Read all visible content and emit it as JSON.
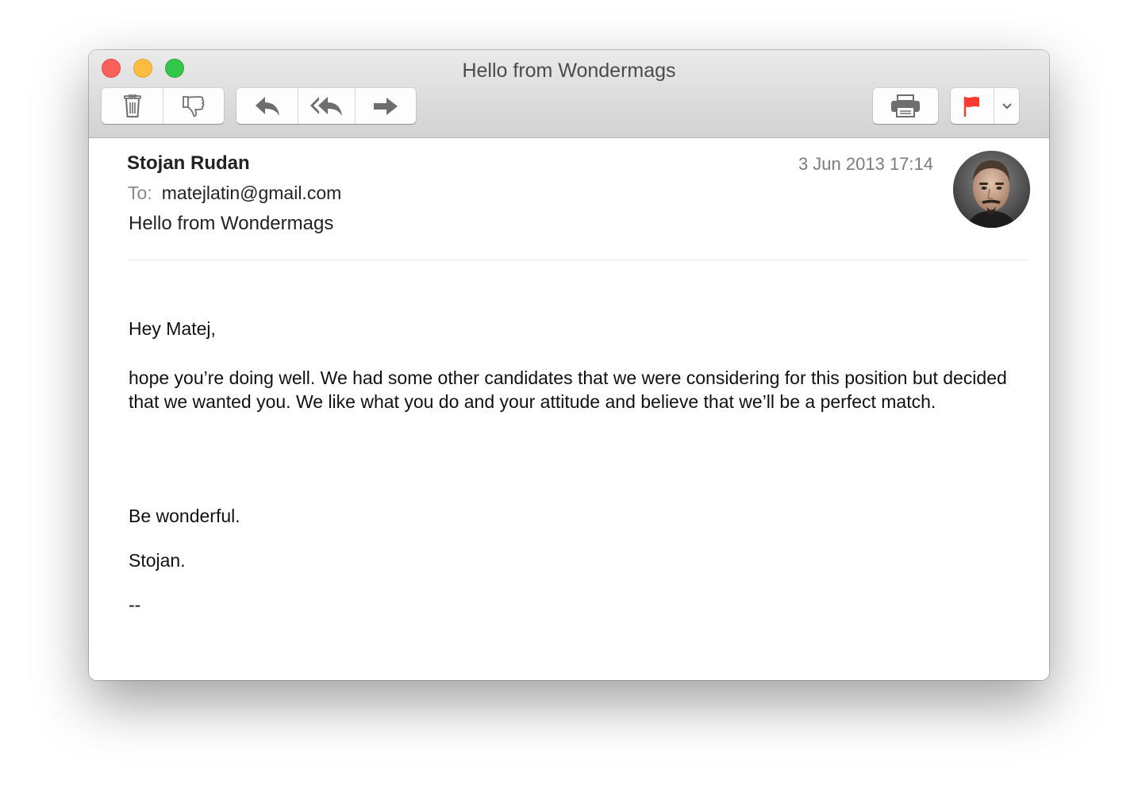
{
  "window": {
    "title": "Hello from Wondermags"
  },
  "toolbar": {
    "buttons": {
      "delete": "trash-icon",
      "junk": "thumbs-down-icon",
      "reply": "reply-icon",
      "reply_all": "reply-all-icon",
      "forward": "forward-icon",
      "print": "print-icon",
      "flag": "flag-icon",
      "flag_menu": "chevron-down-icon"
    },
    "flag_color": "#ff3b30"
  },
  "message": {
    "sender": "Stojan Rudan",
    "date": "3 Jun 2013 17:14",
    "to_label": "To:",
    "to_address": "matejlatin@gmail.com",
    "subject": "Hello from Wondermags",
    "body": {
      "greeting": "Hey Matej,",
      "paragraph": "hope you’re doing well. We had some other candidates that we were considering for this position but decided that we wanted you. We like what you do and your attitude and believe that we’ll be a perfect match.",
      "closing": "Be wonderful.",
      "signoff": "Stojan.",
      "signature_separator": "--"
    }
  },
  "colors": {
    "close": "#fc605c",
    "minimize": "#fdbc40",
    "maximize": "#34c84a"
  }
}
